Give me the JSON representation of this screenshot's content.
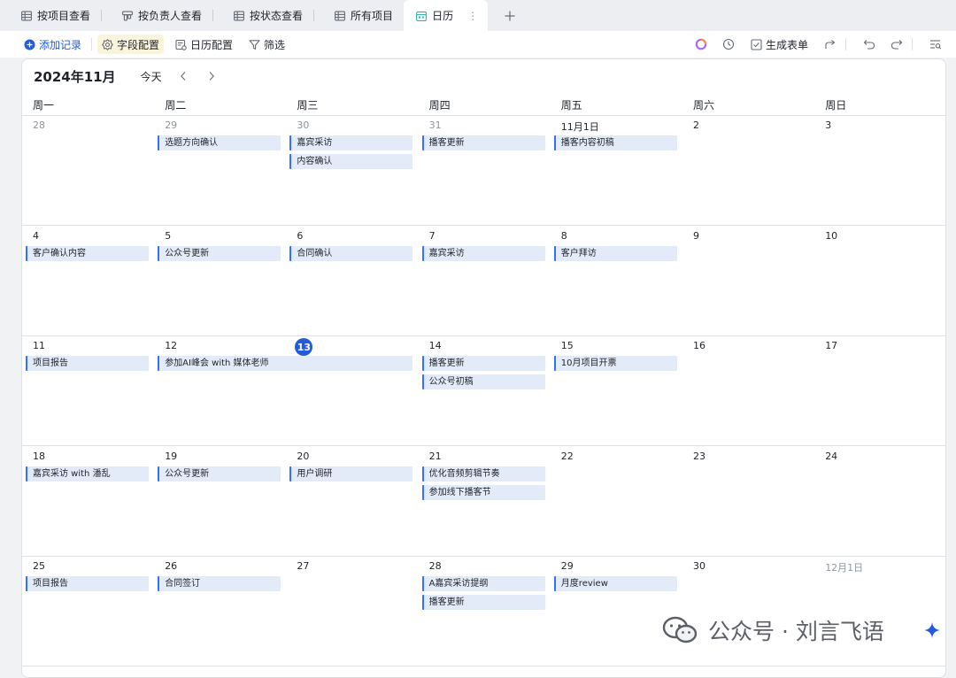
{
  "tabs": [
    {
      "label": "按项目查看",
      "icon": "table-icon",
      "active": false
    },
    {
      "label": "按负责人查看",
      "icon": "kanban-icon",
      "active": false
    },
    {
      "label": "按状态查看",
      "icon": "table-icon",
      "active": false
    },
    {
      "label": "所有项目",
      "icon": "table-icon",
      "active": false
    },
    {
      "label": "日历",
      "icon": "calendar-icon",
      "active": true
    }
  ],
  "toolbar": {
    "add_record": "添加记录",
    "field_config": "字段配置",
    "calendar_config": "日历配置",
    "filter": "筛选",
    "generate_form": "生成表单"
  },
  "calendar": {
    "month_title": "2024年11月",
    "today_label": "今天",
    "weekdays": [
      "周一",
      "周二",
      "周三",
      "周四",
      "周五",
      "周六",
      "周日"
    ],
    "weeks": [
      [
        {
          "label": "28",
          "other": true,
          "events": []
        },
        {
          "label": "29",
          "other": true,
          "events": [
            "选题方向确认"
          ]
        },
        {
          "label": "30",
          "other": true,
          "events": [
            "嘉宾采访",
            "内容确认"
          ]
        },
        {
          "label": "31",
          "other": true,
          "events": [
            "播客更新"
          ]
        },
        {
          "label": "11月1日",
          "other": false,
          "events": [
            "播客内容初稿"
          ]
        },
        {
          "label": "2",
          "other": false,
          "events": []
        },
        {
          "label": "3",
          "other": false,
          "events": []
        }
      ],
      [
        {
          "label": "4",
          "other": false,
          "events": [
            "客户确认内容"
          ]
        },
        {
          "label": "5",
          "other": false,
          "events": [
            "公众号更新"
          ]
        },
        {
          "label": "6",
          "other": false,
          "events": [
            "合同确认"
          ]
        },
        {
          "label": "7",
          "other": false,
          "events": [
            "嘉宾采访"
          ]
        },
        {
          "label": "8",
          "other": false,
          "events": [
            "客户拜访"
          ]
        },
        {
          "label": "9",
          "other": false,
          "events": []
        },
        {
          "label": "10",
          "other": false,
          "events": []
        }
      ],
      [
        {
          "label": "11",
          "other": false,
          "events": [
            "项目报告"
          ]
        },
        {
          "label": "12",
          "other": false,
          "events": []
        },
        {
          "label": "13",
          "other": false,
          "today": true,
          "events": []
        },
        {
          "label": "14",
          "other": false,
          "events": [
            "播客更新",
            "公众号初稿"
          ]
        },
        {
          "label": "15",
          "other": false,
          "events": [
            "10月项目开票"
          ]
        },
        {
          "label": "16",
          "other": false,
          "events": []
        },
        {
          "label": "17",
          "other": false,
          "events": []
        }
      ],
      [
        {
          "label": "18",
          "other": false,
          "events": [
            "嘉宾采访 with 潘乱"
          ]
        },
        {
          "label": "19",
          "other": false,
          "events": [
            "公众号更新"
          ]
        },
        {
          "label": "20",
          "other": false,
          "events": [
            "用户调研"
          ]
        },
        {
          "label": "21",
          "other": false,
          "events": [
            "优化音频剪辑节奏",
            "参加线下播客节"
          ]
        },
        {
          "label": "22",
          "other": false,
          "events": []
        },
        {
          "label": "23",
          "other": false,
          "events": []
        },
        {
          "label": "24",
          "other": false,
          "events": []
        }
      ],
      [
        {
          "label": "25",
          "other": false,
          "events": [
            "项目报告"
          ]
        },
        {
          "label": "26",
          "other": false,
          "events": [
            "合同签订"
          ]
        },
        {
          "label": "27",
          "other": false,
          "events": []
        },
        {
          "label": "28",
          "other": false,
          "events": [
            "A嘉宾采访提纲",
            "播客更新"
          ]
        },
        {
          "label": "29",
          "other": false,
          "events": [
            "月度review"
          ]
        },
        {
          "label": "30",
          "other": false,
          "events": []
        },
        {
          "label": "12月1日",
          "other": true,
          "events": []
        }
      ]
    ],
    "spanning_events": [
      {
        "week": 2,
        "start_day": 1,
        "span": 2,
        "label": "参加AI峰会 with 媒体老师"
      }
    ]
  },
  "watermark": {
    "text": "公众号 · 刘言飞语"
  },
  "colors": {
    "accent": "#245bdb",
    "event_bar": "#3370ff",
    "event_bg": "#e4ebf8",
    "toolbar_highlight": "#fbf4dd"
  }
}
